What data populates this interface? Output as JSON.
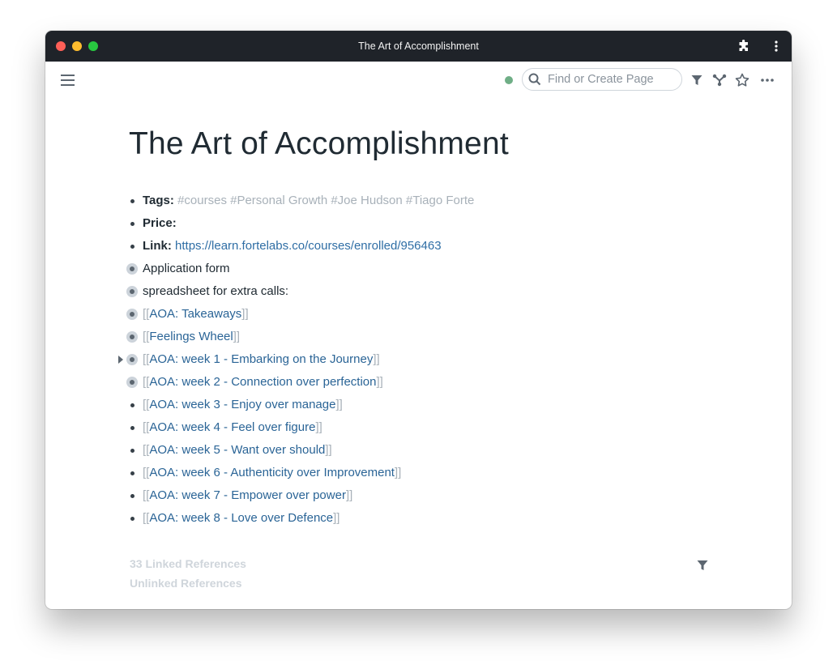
{
  "window": {
    "title": "The Art of Accomplishment",
    "extensions_icon": "puzzle-icon",
    "more_icon": "vertical-dots-icon"
  },
  "topbar": {
    "menu_icon": "hamburger-icon",
    "sync_status_color": "#6fae86",
    "search": {
      "placeholder": "Find or Create Page",
      "value": ""
    },
    "icons": [
      "filter-icon",
      "graph-icon",
      "star-icon",
      "more-horizontal-icon"
    ]
  },
  "page": {
    "title": "The Art of Accomplishment"
  },
  "blocks": [
    {
      "attr": "Tags:",
      "tags": "#courses #Personal Growth #Joe Hudson #Tiago Forte"
    },
    {
      "attr": "Price:"
    },
    {
      "attr": "Link:",
      "url": "https://learn.fortelabs.co/courses/enrolled/956463"
    },
    {
      "text": "Application form"
    },
    {
      "text": "spreadsheet for extra calls:"
    },
    {
      "ref": "AOA: Takeaways"
    },
    {
      "ref": "Feelings Wheel"
    },
    {
      "ref": "AOA: week 1 - Embarking on the Journey"
    },
    {
      "ref": "AOA: week 2 - Connection over perfection"
    },
    {
      "ref": "AOA: week 3 - Enjoy over manage"
    },
    {
      "ref": "AOA: week 4 - Feel over figure"
    },
    {
      "ref": "AOA: week 5 - Want over should"
    },
    {
      "ref": "AOA: week 6 - Authenticity over Improvement"
    },
    {
      "ref": "AOA: week 7 - Empower over power"
    },
    {
      "ref": "AOA: week 8 - Love over Defence"
    }
  ],
  "brackets": {
    "open": "[[",
    "close": "]]"
  },
  "references": {
    "linked": "33 Linked References",
    "unlinked": "Unlinked References",
    "filter_icon": "filter-icon"
  },
  "colors": {
    "link": "#2a6496",
    "tag": "#a8b1b9",
    "titlebar": "#1f2329"
  }
}
